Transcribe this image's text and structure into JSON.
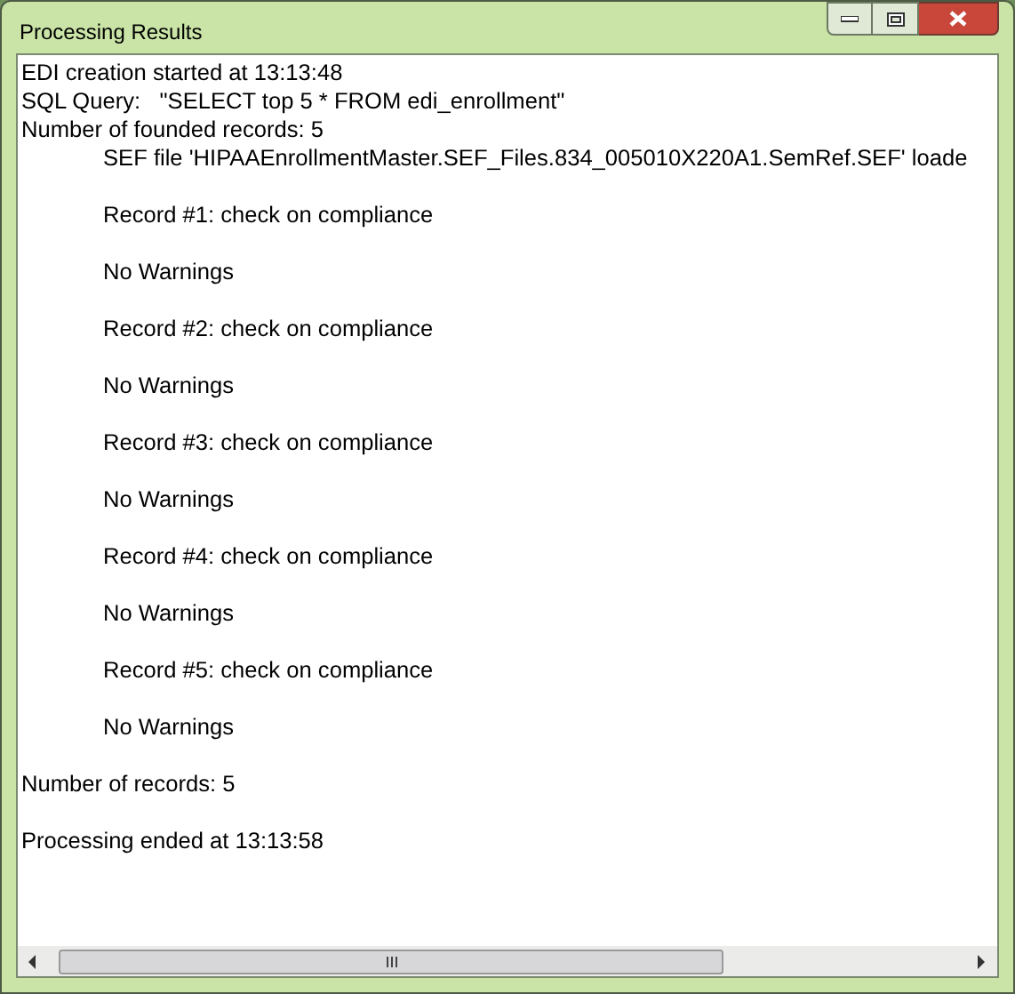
{
  "window": {
    "title": "Processing Results"
  },
  "log": {
    "header": [
      "EDI creation started at 13:13:48",
      "SQL Query:   \"SELECT top 5 * FROM edi_enrollment\"",
      "Number of founded records: 5"
    ],
    "sef_line": "SEF file 'HIPAAEnrollmentMaster.SEF_Files.834_005010X220A1.SemRef.SEF' loade",
    "records": [
      {
        "check": "Record #1: check on compliance",
        "result": "No Warnings"
      },
      {
        "check": "Record #2: check on compliance",
        "result": "No Warnings"
      },
      {
        "check": "Record #3: check on compliance",
        "result": "No Warnings"
      },
      {
        "check": "Record #4: check on compliance",
        "result": "No Warnings"
      },
      {
        "check": "Record #5: check on compliance",
        "result": "No Warnings"
      }
    ],
    "summary": [
      "Number of records: 5",
      "Processing ended at 13:13:58"
    ]
  }
}
